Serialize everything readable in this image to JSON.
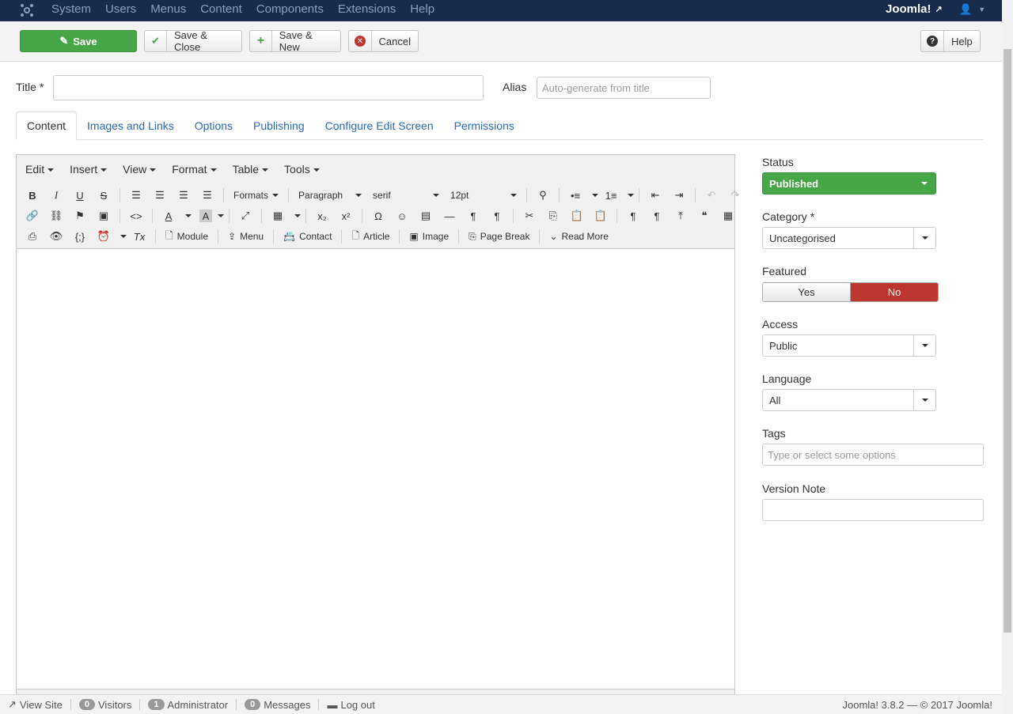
{
  "topnav": {
    "menu": [
      "System",
      "Users",
      "Menus",
      "Content",
      "Components",
      "Extensions",
      "Help"
    ],
    "brand": "Joomla!"
  },
  "toolbar": {
    "save": "Save",
    "save_close": "Save & Close",
    "save_new": "Save & New",
    "cancel": "Cancel",
    "help": "Help"
  },
  "form": {
    "title_label": "Title *",
    "title_value": "",
    "alias_label": "Alias",
    "alias_placeholder": "Auto-generate from title"
  },
  "tabs": [
    "Content",
    "Images and Links",
    "Options",
    "Publishing",
    "Configure Edit Screen",
    "Permissions"
  ],
  "editor": {
    "menus": [
      "Edit",
      "Insert",
      "View",
      "Format",
      "Table",
      "Tools"
    ],
    "formats": "Formats",
    "block": "Paragraph",
    "font": "serif",
    "size": "12pt",
    "buttons": {
      "module": "Module",
      "menu": "Menu",
      "contact": "Contact",
      "article": "Article",
      "image": "Image",
      "page_break": "Page Break",
      "read_more": "Read More"
    }
  },
  "sidebar": {
    "status_label": "Status",
    "status_value": "Published",
    "category_label": "Category *",
    "category_value": "Uncategorised",
    "featured_label": "Featured",
    "featured_yes": "Yes",
    "featured_no": "No",
    "access_label": "Access",
    "access_value": "Public",
    "language_label": "Language",
    "language_value": "All",
    "tags_label": "Tags",
    "tags_placeholder": "Type or select some options",
    "version_label": "Version Note"
  },
  "footer": {
    "view_site": "View Site",
    "visitors_count": "0",
    "visitors": "Visitors",
    "admin_count": "1",
    "admin": "Administrator",
    "messages_count": "0",
    "messages": "Messages",
    "logout": "Log out",
    "version": "Joomla! 3.8.2 — © 2017 Joomla!"
  },
  "colors": {
    "nav": "#172b4c",
    "success": "#46a546",
    "danger": "#bd362f",
    "link": "#2a69b8"
  }
}
